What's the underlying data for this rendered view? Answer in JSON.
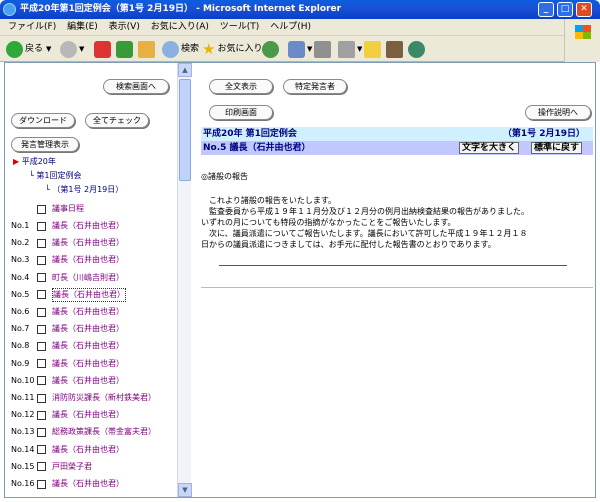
{
  "window": {
    "title": "平成20年第1回定例会（第1号 2月19日） - Microsoft Internet Explorer"
  },
  "menu": [
    "ファイル(F)",
    "編集(E)",
    "表示(V)",
    "お気に入り(A)",
    "ツール(T)",
    "ヘルプ(H)"
  ],
  "toolbar": {
    "back": "戻る",
    "search": "検索",
    "favorites": "お気に入り"
  },
  "left": {
    "search_screen": "検索画面へ",
    "download": "ダウンロード",
    "check_all": "全てチェック",
    "speaker_display": "発言管理表示",
    "tree": {
      "year": "平成20年",
      "session": "第1回定例会",
      "issue": "（第1号 2月19日）"
    },
    "agenda": "議事日程",
    "items": [
      {
        "no": "No.1",
        "label": "議長（石井由也君）"
      },
      {
        "no": "No.2",
        "label": "議長（石井由也君）"
      },
      {
        "no": "No.3",
        "label": "議長（石井由也君）"
      },
      {
        "no": "No.4",
        "label": "町長（川嶋吉則君）"
      },
      {
        "no": "No.5",
        "label": "議長（石井由也君）"
      },
      {
        "no": "No.6",
        "label": "議長（石井由也君）"
      },
      {
        "no": "No.7",
        "label": "議長（石井由也君）"
      },
      {
        "no": "No.8",
        "label": "議長（石井由也君）"
      },
      {
        "no": "No.9",
        "label": "議長（石井由也君）"
      },
      {
        "no": "No.10",
        "label": "議長（石井由也君）"
      },
      {
        "no": "No.11",
        "label": "消防防災課長（新村鉄美君）"
      },
      {
        "no": "No.12",
        "label": "議長（石井由也君）"
      },
      {
        "no": "No.13",
        "label": "総務政策課長（帯金富夫君）"
      },
      {
        "no": "No.14",
        "label": "議長（石井由也君）"
      },
      {
        "no": "No.15",
        "label": "戸田榮子君"
      },
      {
        "no": "No.16",
        "label": "議長（石井由也君）"
      }
    ]
  },
  "right": {
    "full_display": "全文表示",
    "specific_speaker": "特定発言者",
    "print_screen": "印刷画面",
    "operation_help": "操作説明へ",
    "header_session": "平成20年 第1回定例会",
    "header_issue": "（第1号 2月19日）",
    "header_speaker": "No.5 議長（石井由也君）",
    "text_larger": "文字を大きく",
    "text_reset": "標準に戻す",
    "section_title": "◎諸般の報告",
    "paragraphs": [
      "　これより諸般の報告をいたします。",
      "　監査委員から平成１９年１１月分及び１２月分の例月出納検査結果の報告がありました。",
      "いずれの月についても特段の指摘がなかったことをご報告いたします。",
      "　次に、議員派遣についてご報告いたします。議長において許可した平成１９年１２月１８",
      "日からの議員派遣につきましては、お手元に配付した報告書のとおりであります。"
    ]
  }
}
